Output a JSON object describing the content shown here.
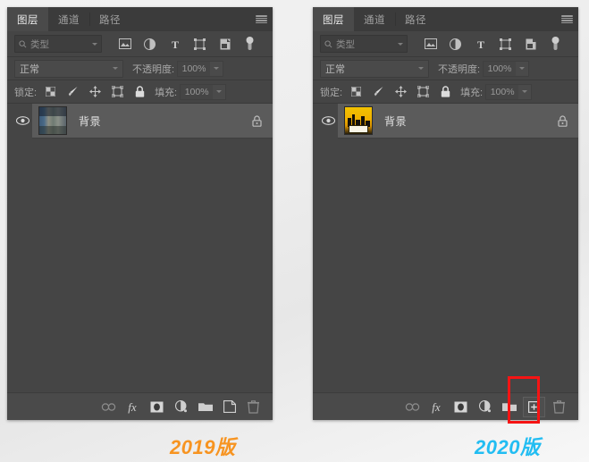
{
  "captions": {
    "left": "2019版",
    "right": "2020版",
    "left_color": "#f79421",
    "right_color": "#22bdf2"
  },
  "panel": {
    "tabs": [
      {
        "label": "图层",
        "active": true
      },
      {
        "label": "通道",
        "active": false
      },
      {
        "label": "路径",
        "active": false
      }
    ],
    "menu_icon": "hamburger-menu-icon",
    "filter_row": {
      "search_placeholder": "类型",
      "search_icon": "search-icon",
      "dropdown_caret": "chevron-down-icon",
      "icons": [
        {
          "name": "pixel-layer-filter-icon",
          "glyph": "image"
        },
        {
          "name": "adjustment-layer-filter-icon",
          "glyph": "halfcircle"
        },
        {
          "name": "type-layer-filter-icon",
          "glyph": "T"
        },
        {
          "name": "shape-layer-filter-icon",
          "glyph": "shape"
        },
        {
          "name": "smart-object-filter-icon",
          "glyph": "smart"
        },
        {
          "name": "filter-toggle-switch-icon",
          "glyph": "toggle"
        }
      ]
    },
    "blend_row": {
      "mode_value": "正常",
      "mode_caret": "chevron-down-icon",
      "opacity_label": "不透明度:",
      "opacity_value": "100%",
      "opacity_caret": "chevron-down-icon"
    },
    "lock_row": {
      "lock_label": "锁定:",
      "icons": [
        {
          "name": "lock-transparent-pixels-icon",
          "glyph": "checker"
        },
        {
          "name": "lock-image-pixels-icon",
          "glyph": "brush"
        },
        {
          "name": "lock-position-icon",
          "glyph": "move"
        },
        {
          "name": "lock-artboard-nesting-icon",
          "glyph": "artboard"
        },
        {
          "name": "lock-all-icon",
          "glyph": "lock"
        }
      ],
      "fill_label": "填充:",
      "fill_value": "100%",
      "fill_caret": "chevron-down-icon"
    },
    "layer": {
      "visibility_icon": "eye-icon",
      "name": "背景",
      "lock_icon": "lock-icon"
    },
    "bottom_toolbar_2019": [
      {
        "name": "link-layers-button",
        "glyph": "link",
        "dim": true,
        "boxed": false
      },
      {
        "name": "layer-style-button",
        "glyph": "fx",
        "dim": false,
        "boxed": false
      },
      {
        "name": "layer-mask-button",
        "glyph": "mask",
        "dim": false,
        "boxed": false
      },
      {
        "name": "new-fill-adjustment-layer-button",
        "glyph": "adjust",
        "dim": false,
        "boxed": false
      },
      {
        "name": "new-group-button",
        "glyph": "folder",
        "dim": false,
        "boxed": false
      },
      {
        "name": "new-layer-button",
        "glyph": "newlayer",
        "dim": false,
        "boxed": false
      },
      {
        "name": "delete-layer-button",
        "glyph": "trash",
        "dim": true,
        "boxed": false
      }
    ],
    "bottom_toolbar_2020": [
      {
        "name": "link-layers-button",
        "glyph": "link",
        "dim": true,
        "boxed": false
      },
      {
        "name": "layer-style-button",
        "glyph": "fx",
        "dim": false,
        "boxed": false
      },
      {
        "name": "layer-mask-button",
        "glyph": "mask",
        "dim": false,
        "boxed": false
      },
      {
        "name": "new-fill-adjustment-layer-button",
        "glyph": "adjust",
        "dim": false,
        "boxed": false
      },
      {
        "name": "new-group-button",
        "glyph": "folder",
        "dim": false,
        "boxed": false
      },
      {
        "name": "new-layer-button",
        "glyph": "plusbox",
        "dim": false,
        "boxed": true
      },
      {
        "name": "delete-layer-button",
        "glyph": "trash",
        "dim": true,
        "boxed": false
      }
    ]
  },
  "annotation": {
    "highlight_color": "#f51414",
    "target": "new-layer-button"
  }
}
